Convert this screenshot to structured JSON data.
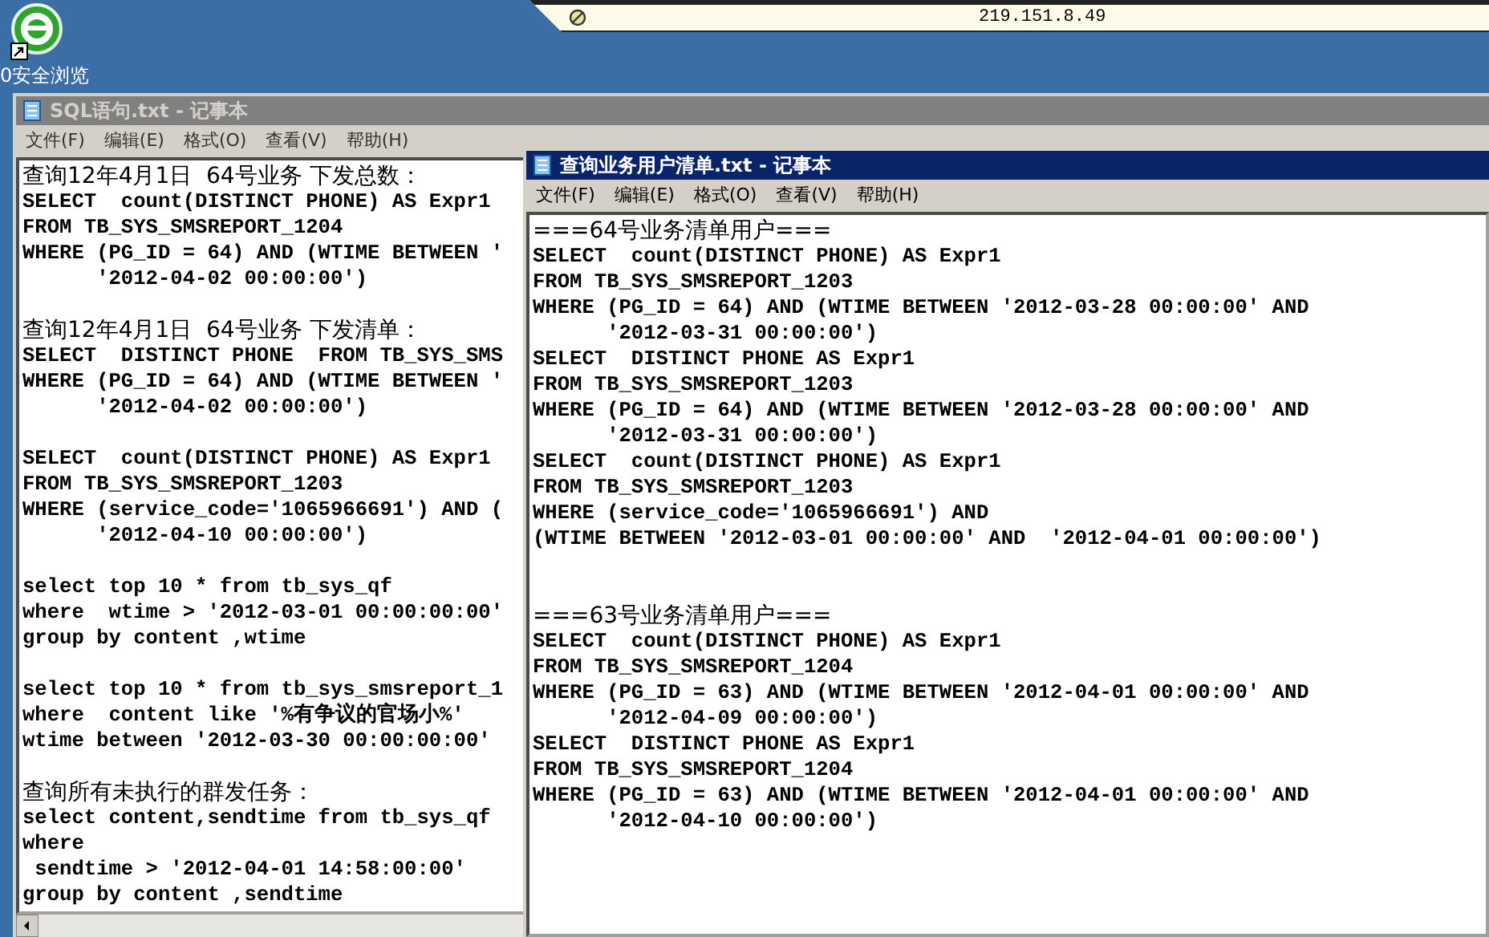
{
  "desktop_icon": {
    "label": "0安全浏览"
  },
  "address_bar": {
    "text": "219.151.8.49"
  },
  "windows": [
    {
      "kind": "back",
      "title": "SQL语句.txt - 记事本",
      "active": false,
      "menu": [
        "文件(F)",
        "编辑(E)",
        "格式(O)",
        "查看(V)",
        "帮助(H)"
      ],
      "blocks": [
        {
          "heading": "查询12年4月1日  64号业务 下发总数：",
          "lines": [
            "SELECT  count(DISTINCT PHONE) AS Expr1",
            "FROM TB_SYS_SMSREPORT_1204",
            "WHERE (PG_ID = 64) AND (WTIME BETWEEN '",
            "      '2012-04-02 00:00:00')"
          ]
        },
        {
          "heading": "查询12年4月1日  64号业务 下发清单：",
          "lines": [
            "SELECT  DISTINCT PHONE  FROM TB_SYS_SMS",
            "WHERE (PG_ID = 64) AND (WTIME BETWEEN '",
            "      '2012-04-02 00:00:00')"
          ]
        },
        {
          "lines": [
            "SELECT  count(DISTINCT PHONE) AS Expr1",
            "FROM TB_SYS_SMSREPORT_1203",
            "WHERE (service_code='1065966691') AND (",
            "      '2012-04-10 00:00:00')"
          ]
        },
        {
          "lines": [
            "select top 10 * from tb_sys_qf",
            "where  wtime > '2012-03-01 00:00:00:00'",
            "group by content ,wtime"
          ]
        },
        {
          "lines": [
            "select top 10 * from tb_sys_smsreport_1",
            "where  content like '%有争议的官场小%'",
            "wtime between '2012-03-30 00:00:00:00'"
          ]
        },
        {
          "heading": "查询所有未执行的群发任务：",
          "lines": [
            "select content,sendtime from tb_sys_qf",
            "where",
            " sendtime > '2012-04-01 14:58:00:00'",
            "group by content ,sendtime"
          ]
        }
      ]
    },
    {
      "kind": "front",
      "title": "查询业务用户清单.txt - 记事本",
      "active": true,
      "menu": [
        "文件(F)",
        "编辑(E)",
        "格式(O)",
        "查看(V)",
        "帮助(H)"
      ],
      "blocks": [
        {
          "heading": "===64号业务清单用户===",
          "lines": [
            "SELECT  count(DISTINCT PHONE) AS Expr1",
            "FROM TB_SYS_SMSREPORT_1203",
            "WHERE (PG_ID = 64) AND (WTIME BETWEEN '2012-03-28 00:00:00' AND",
            "      '2012-03-31 00:00:00')",
            "SELECT  DISTINCT PHONE AS Expr1",
            "FROM TB_SYS_SMSREPORT_1203",
            "WHERE (PG_ID = 64) AND (WTIME BETWEEN '2012-03-28 00:00:00' AND",
            "      '2012-03-31 00:00:00')",
            "SELECT  count(DISTINCT PHONE) AS Expr1",
            "FROM TB_SYS_SMSREPORT_1203",
            "WHERE (service_code='1065966691') AND",
            "(WTIME BETWEEN '2012-03-01 00:00:00' AND  '2012-04-01 00:00:00')"
          ]
        },
        {
          "heading": "===63号业务清单用户===",
          "lines": [
            "SELECT  count(DISTINCT PHONE) AS Expr1",
            "FROM TB_SYS_SMSREPORT_1204",
            "WHERE (PG_ID = 63) AND (WTIME BETWEEN '2012-04-01 00:00:00' AND",
            "      '2012-04-09 00:00:00')",
            "SELECT  DISTINCT PHONE AS Expr1",
            "FROM TB_SYS_SMSREPORT_1204",
            "WHERE (PG_ID = 63) AND (WTIME BETWEEN '2012-04-01 00:00:00' AND",
            "      '2012-04-10 00:00:00')"
          ]
        }
      ]
    }
  ]
}
